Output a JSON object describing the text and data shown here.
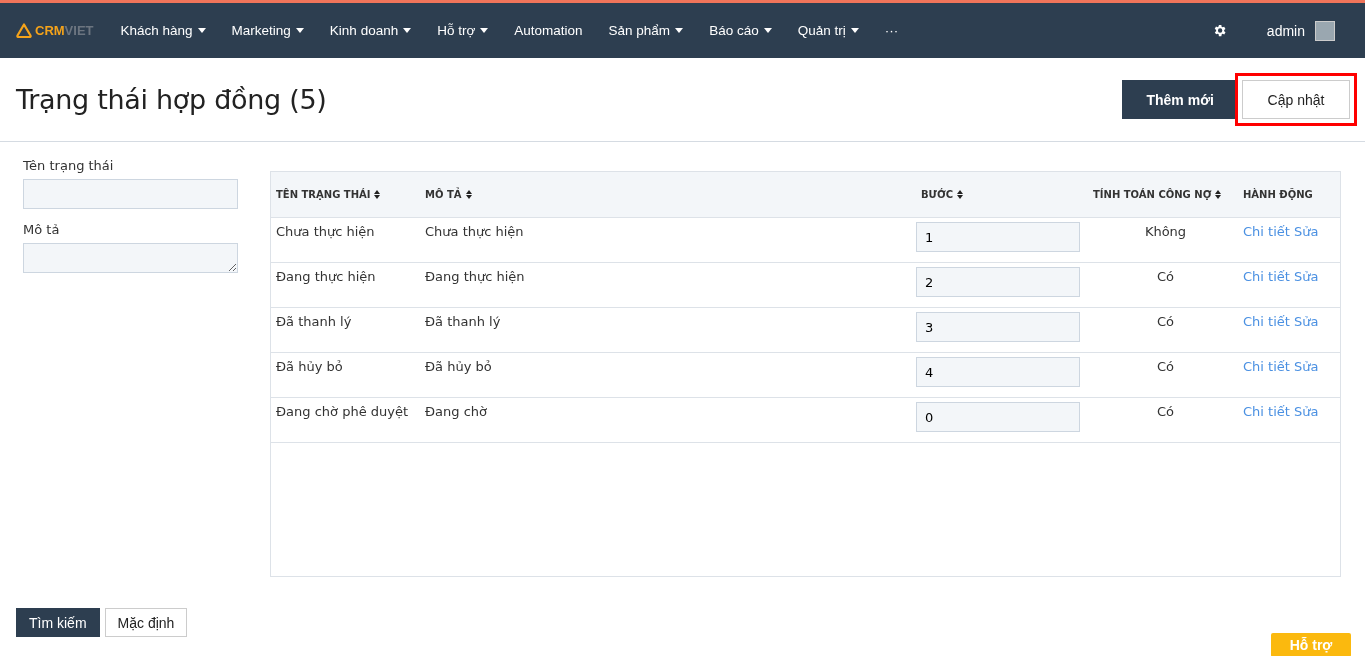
{
  "logo": {
    "part_1": "CRM",
    "part_2": "VIET"
  },
  "nav": [
    {
      "label": "Khách hàng",
      "dropdown": true
    },
    {
      "label": "Marketing",
      "dropdown": true
    },
    {
      "label": "Kinh doanh",
      "dropdown": true
    },
    {
      "label": "Hỗ trợ",
      "dropdown": true
    },
    {
      "label": "Automation",
      "dropdown": false
    },
    {
      "label": "Sản phẩm",
      "dropdown": true
    },
    {
      "label": "Báo cáo",
      "dropdown": true
    },
    {
      "label": "Quản trị",
      "dropdown": true
    },
    {
      "label": "···",
      "dropdown": false
    }
  ],
  "user": {
    "name": "admin"
  },
  "page": {
    "title": "Trạng thái hợp đồng (5)",
    "buttons": [
      {
        "label": "Thêm mới",
        "kind": "primary",
        "highlighted": false
      },
      {
        "label": "Cập nhật",
        "kind": "default",
        "highlighted": true
      }
    ]
  },
  "filters": [
    {
      "label": "Tên trạng thái",
      "kind": "input"
    },
    {
      "label": "Mô tả",
      "kind": "textarea"
    }
  ],
  "table": {
    "columns": [
      {
        "label": "TÊN TRẠNG THÁI",
        "sortable": true
      },
      {
        "label": "MÔ TẢ",
        "sortable": true
      },
      {
        "label": "BƯỚC",
        "sortable": true
      },
      {
        "label": "TÍNH TOÁN CÔNG NỢ",
        "sortable": true
      },
      {
        "label": "HÀNH ĐỘNG",
        "sortable": false
      }
    ],
    "rows": [
      {
        "name": "Chưa thực hiện",
        "description": "Chưa thực hiện",
        "step": "1",
        "debt": "Không",
        "actions": [
          "Chi tiết",
          "Sửa"
        ]
      },
      {
        "name": "Đang thực hiện",
        "description": "Đang thực hiện",
        "step": "2",
        "debt": "Có",
        "actions": [
          "Chi tiết",
          "Sửa"
        ]
      },
      {
        "name": "Đã thanh lý",
        "description": "Đã thanh lý",
        "step": "3",
        "debt": "Có",
        "actions": [
          "Chi tiết",
          "Sửa"
        ]
      },
      {
        "name": "Đã hủy bỏ",
        "description": "Đã hủy bỏ",
        "step": "4",
        "debt": "Có",
        "actions": [
          "Chi tiết",
          "Sửa"
        ]
      },
      {
        "name": "Đang chờ phê duyệt",
        "description": "Đang chờ",
        "step": "0",
        "debt": "Có",
        "actions": [
          "Chi tiết",
          "Sửa"
        ]
      }
    ]
  },
  "footer_buttons": [
    {
      "label": "Tìm kiếm",
      "kind": "primary"
    },
    {
      "label": "Mặc định",
      "kind": "default"
    }
  ],
  "help_button": {
    "label": "Hỗ trợ"
  }
}
